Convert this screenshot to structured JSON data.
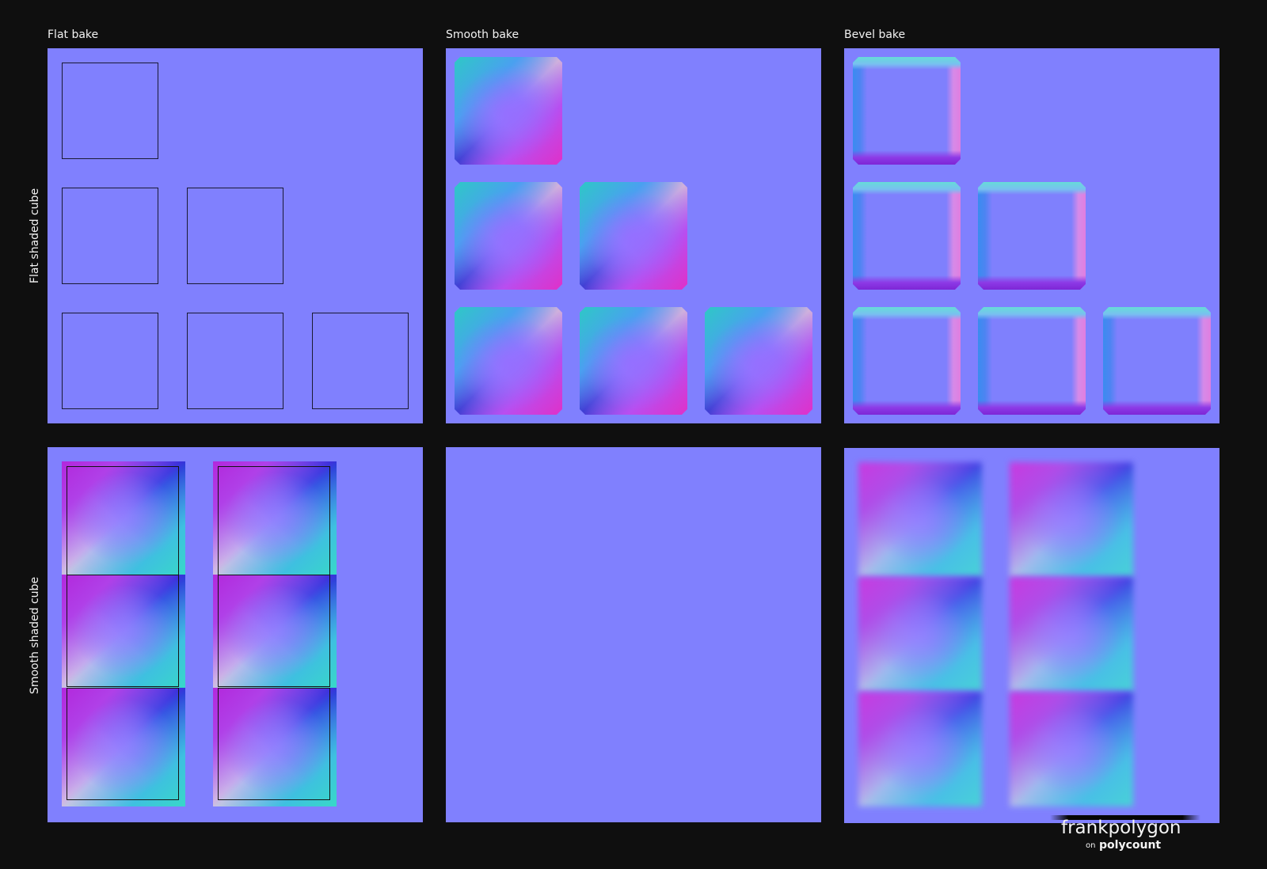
{
  "columns": {
    "flat_bake": "Flat bake",
    "smooth_bake": "Smooth bake",
    "bevel_bake": "Bevel bake"
  },
  "rows": {
    "flat_shaded": "Flat shaded cube",
    "smooth_shaded": "Smooth shaded cube"
  },
  "watermark": {
    "name": "frankpolygon",
    "on": "on",
    "site": "polycount"
  },
  "colors": {
    "background": "#0f0f0f",
    "normal_flat": "#8080fe",
    "text": "#f2f2f2"
  }
}
